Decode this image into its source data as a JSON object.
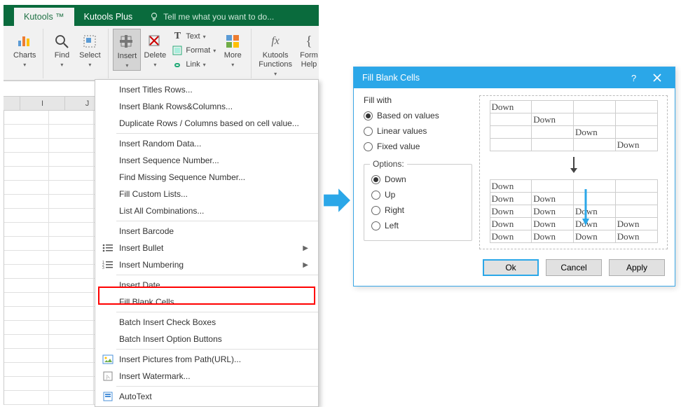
{
  "titlebar": {
    "tabs": [
      "Kutools ™",
      "Kutools Plus"
    ],
    "tellme": "Tell me what you want to do..."
  },
  "ribbon": {
    "charts": "Charts",
    "find": "Find",
    "select": "Select",
    "insert": "Insert",
    "delete": "Delete",
    "text": "Text",
    "format": "Format",
    "link": "Link",
    "more": "More",
    "kfunc_top": "Kutools",
    "kfunc_bot": "Functions",
    "formh": "Form",
    "formh2": "Help"
  },
  "colheaders": [
    "I",
    "J"
  ],
  "menu": {
    "items": [
      "Insert Titles Rows...",
      "Insert Blank Rows&Columns...",
      "Duplicate Rows / Columns based on cell value...",
      "Insert Random Data...",
      "Insert Sequence Number...",
      "Find Missing Sequence Number...",
      "Fill Custom Lists...",
      "List All Combinations...",
      "Insert Barcode",
      "Insert Bullet",
      "Insert Numbering",
      "Insert Date...",
      "Fill Blank Cells...",
      "Batch Insert Check Boxes",
      "Batch Insert Option Buttons",
      "Insert Pictures from Path(URL)...",
      "Insert Watermark...",
      "AutoText"
    ]
  },
  "dialog": {
    "title": "Fill Blank Cells",
    "fillwith_label": "Fill with",
    "fillwith": [
      "Based on values",
      "Linear values",
      "Fixed value"
    ],
    "options_label": "Options:",
    "options": [
      "Down",
      "Up",
      "Right",
      "Left"
    ],
    "buttons": {
      "ok": "Ok",
      "cancel": "Cancel",
      "apply": "Apply"
    },
    "sample_word": "Down"
  }
}
